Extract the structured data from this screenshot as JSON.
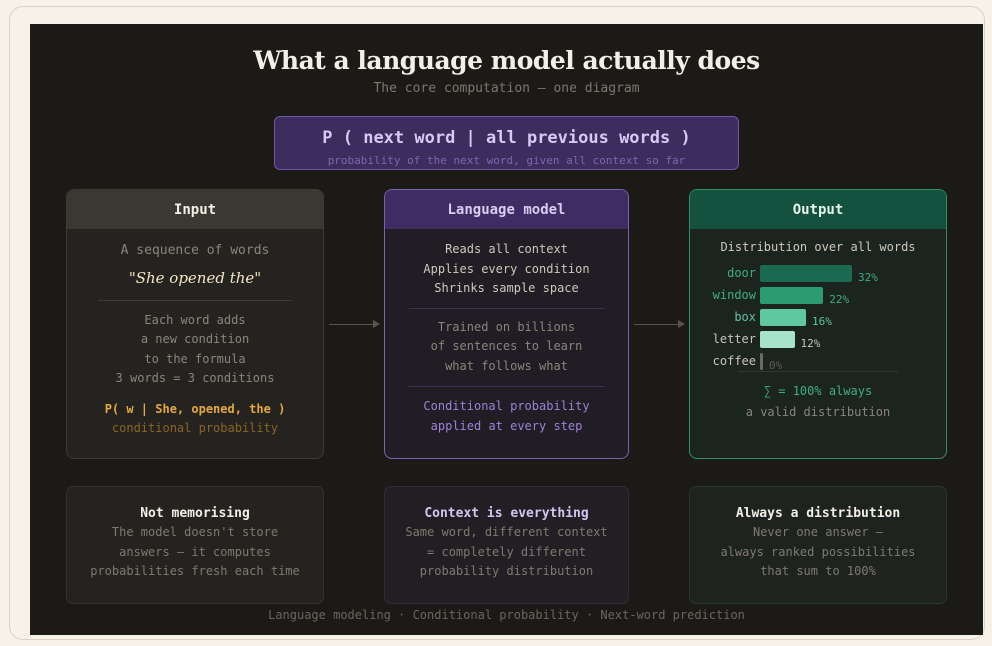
{
  "title": "What a language model actually does",
  "subtitle": "The core computation — one diagram",
  "formula": {
    "main": "P ( next word | all previous words )",
    "sub": "probability of the next word, given all context so far"
  },
  "input": {
    "header": "Input",
    "label": "A sequence of words",
    "quote": "\"She opened the\"",
    "lines": [
      "Each word adds",
      "a new condition",
      "to the formula",
      "3 words = 3 conditions"
    ],
    "formula": "P( w | She, opened, the )",
    "formula_note": "conditional probability"
  },
  "model": {
    "header": "Language model",
    "lines1": [
      "Reads all context",
      "Applies every condition",
      "Shrinks sample space"
    ],
    "lines2": [
      "Trained on billions",
      "of sentences to learn",
      "what follows what"
    ],
    "lines3": [
      "Conditional probability",
      "applied at every step"
    ]
  },
  "output": {
    "header": "Output",
    "label": "Distribution over all words",
    "bars": [
      {
        "word": "door",
        "value": 32,
        "label": "32%",
        "color": "#1a6a51",
        "text_color": "#3fae83"
      },
      {
        "word": "window",
        "value": 22,
        "label": "22%",
        "color": "#2b9c72",
        "text_color": "#3fae83"
      },
      {
        "word": "box",
        "value": 16,
        "label": "16%",
        "color": "#5fc7a2",
        "text_color": "#5ec4a0"
      },
      {
        "word": "letter",
        "value": 12,
        "label": "12%",
        "color": "#a7e3cb",
        "text_color": "#c9c3b8"
      },
      {
        "word": "coffee",
        "value": 0,
        "label": "0%",
        "color": "#6c6a64",
        "text_color": "#c9c3b8"
      }
    ],
    "sum": "∑ = 100% always",
    "sum_note": "a valid distribution"
  },
  "bottom": [
    {
      "title": "Not memorising",
      "lines": [
        "The model doesn't store",
        "answers — it computes",
        "probabilities fresh each time"
      ]
    },
    {
      "title": "Context is everything",
      "lines": [
        "Same word, different context",
        "= completely different",
        "probability distribution"
      ]
    },
    {
      "title": "Always a distribution",
      "lines": [
        "Never one answer —",
        "always ranked possibilities",
        "that sum to 100%"
      ]
    }
  ],
  "footer": "Language modeling · Conditional probability · Next-word prediction"
}
